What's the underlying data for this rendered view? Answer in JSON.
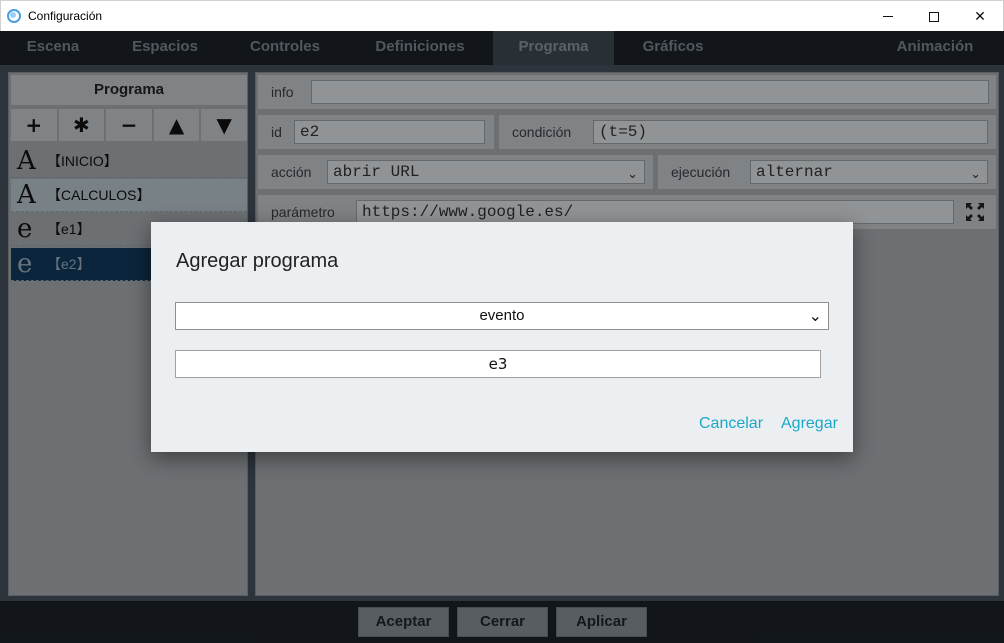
{
  "window": {
    "title": "Configuración"
  },
  "tabs": [
    {
      "label": "Escena"
    },
    {
      "label": "Espacios"
    },
    {
      "label": "Controles"
    },
    {
      "label": "Definiciones"
    },
    {
      "label": "Programa"
    },
    {
      "label": "Gráficos"
    },
    {
      "label": "Animación"
    }
  ],
  "active_tab": "Programa",
  "left_panel": {
    "title": "Programa",
    "tools": [
      "+",
      "✱",
      "−",
      "▲",
      "▼"
    ],
    "items": [
      {
        "glyph": "A",
        "label": "【INICIO】"
      },
      {
        "glyph": "A",
        "label": "【CALCULOS】"
      },
      {
        "glyph": "e",
        "label": "【e1】"
      },
      {
        "glyph": "e",
        "label": "【e2】"
      }
    ]
  },
  "right_panel": {
    "info_label": "info",
    "info_value": "",
    "id_label": "id",
    "id_value": "e2",
    "condition_label": "condición",
    "condition_value": "(t=5)",
    "action_label": "acción",
    "action_value": "abrir URL",
    "execution_label": "ejecución",
    "execution_value": "alternar",
    "param_label": "parámetro",
    "param_value": "https://www.google.es/"
  },
  "bottom_buttons": {
    "accept": "Aceptar",
    "close": "Cerrar",
    "apply": "Aplicar"
  },
  "dialog": {
    "title": "Agregar programa",
    "type_value": "evento",
    "name_value": "e3",
    "cancel_label": "Cancelar",
    "add_label": "Agregar"
  },
  "colors": {
    "accent": "#1aa8c7",
    "selection": "#123a5c",
    "dark_bg": "#1c232a"
  }
}
